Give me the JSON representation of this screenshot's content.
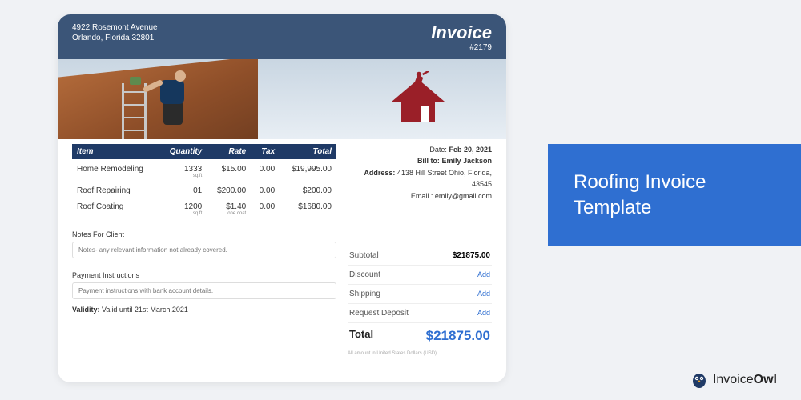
{
  "header": {
    "address_line1": "4922 Rosemont Avenue",
    "address_line2": "Orlando, Florida 32801",
    "title": "Invoice",
    "number": "#2179"
  },
  "columns": {
    "item": "Item",
    "qty": "Quantity",
    "rate": "Rate",
    "tax": "Tax",
    "total": "Total"
  },
  "items": [
    {
      "name": "Home Remodeling",
      "qty": "1333",
      "qty_sub": "sq.ft",
      "rate": "$15.00",
      "rate_sub": "",
      "tax": "0.00",
      "total": "$19,995.00"
    },
    {
      "name": "Roof Repairing",
      "qty": "01",
      "qty_sub": "",
      "rate": "$200.00",
      "rate_sub": "",
      "tax": "0.00",
      "total": "$200.00"
    },
    {
      "name": "Roof Coating",
      "qty": "1200",
      "qty_sub": "sq.ft",
      "rate": "$1.40",
      "rate_sub": "one coat",
      "tax": "0.00",
      "total": "$1680.00"
    }
  ],
  "notes": {
    "label": "Notes For Client",
    "placeholder": "Notes- any relevant information not already covered."
  },
  "payment": {
    "label": "Payment Instructions",
    "placeholder": "Payment instructions with bank account details."
  },
  "validity": {
    "label": "Validity:",
    "value": "Valid until 21st March,2021"
  },
  "bill": {
    "date_label": "Date:",
    "date": "Feb 20, 2021",
    "to_label": "Bill to:",
    "to": "Emily Jackson",
    "addr_label": "Address:",
    "addr": "4138 Hill Street Ohio, Florida, 43545",
    "email_label": "Email :",
    "email": "emily@gmail.com"
  },
  "totals": {
    "subtotal_label": "Subtotal",
    "subtotal": "$21875.00",
    "discount_label": "Discount",
    "discount_action": "Add",
    "shipping_label": "Shipping",
    "shipping_action": "Add",
    "deposit_label": "Request Deposit",
    "deposit_action": "Add",
    "grand_label": "Total",
    "grand": "$21875.00",
    "note": "All amount in United States Dollars (USD)"
  },
  "side_panel": {
    "line1": "Roofing Invoice",
    "line2": "Template"
  },
  "brand": {
    "name_light": "Invoice",
    "name_bold": "Owl"
  },
  "colors": {
    "accent": "#2f6fd1",
    "header": "#3b5578",
    "logo": "#9a1f28"
  }
}
